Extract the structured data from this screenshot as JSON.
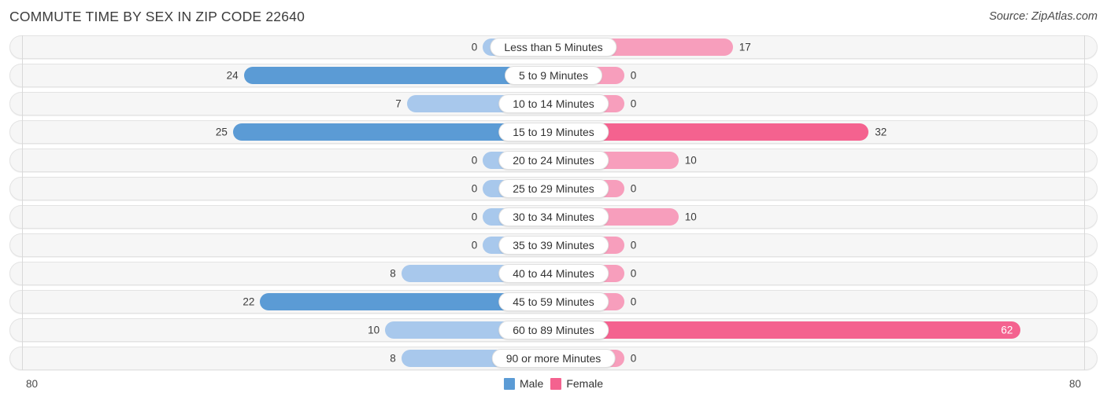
{
  "header": {
    "title": "COMMUTE TIME BY SEX IN ZIP CODE 22640",
    "source": "Source: ZipAtlas.com"
  },
  "legend": {
    "male_label": "Male",
    "female_label": "Female",
    "male_color": "#5b9bd5",
    "female_color": "#f4628f"
  },
  "axis": {
    "left_label": "80",
    "right_label": "80"
  },
  "chart_data": {
    "type": "bar",
    "title": "COMMUTE TIME BY SEX IN ZIP CODE 22640",
    "orientation": "horizontal-diverging",
    "xlabel": "",
    "ylabel": "",
    "xlim": [
      80,
      80
    ],
    "grid": false,
    "legend_position": "bottom-center",
    "categories": [
      "Less than 5 Minutes",
      "5 to 9 Minutes",
      "10 to 14 Minutes",
      "15 to 19 Minutes",
      "20 to 24 Minutes",
      "25 to 29 Minutes",
      "30 to 34 Minutes",
      "35 to 39 Minutes",
      "40 to 44 Minutes",
      "45 to 59 Minutes",
      "60 to 89 Minutes",
      "90 or more Minutes"
    ],
    "series": [
      {
        "name": "Male",
        "color": "#5b9bd5",
        "values": [
          0,
          24,
          7,
          25,
          0,
          0,
          0,
          0,
          8,
          22,
          10,
          8
        ]
      },
      {
        "name": "Female",
        "color": "#f4628f",
        "values": [
          17,
          0,
          0,
          32,
          10,
          0,
          10,
          0,
          0,
          0,
          62,
          0
        ]
      }
    ]
  },
  "rows": [
    {
      "label": "Less than 5 Minutes",
      "male": "0",
      "female": "17",
      "male_pct": 13,
      "female_pct": 33,
      "male_strong": false,
      "female_strong": false,
      "female_inside": false
    },
    {
      "label": "5 to 9 Minutes",
      "male": "24",
      "female": "0",
      "male_pct": 57,
      "female_pct": 13,
      "male_strong": true,
      "female_strong": false,
      "female_inside": false
    },
    {
      "label": "10 to 14 Minutes",
      "male": "7",
      "female": "0",
      "male_pct": 27,
      "female_pct": 13,
      "male_strong": false,
      "female_strong": false,
      "female_inside": false
    },
    {
      "label": "15 to 19 Minutes",
      "male": "25",
      "female": "32",
      "male_pct": 59,
      "female_pct": 58,
      "male_strong": true,
      "female_strong": true,
      "female_inside": false
    },
    {
      "label": "20 to 24 Minutes",
      "male": "0",
      "female": "10",
      "male_pct": 13,
      "female_pct": 23,
      "male_strong": false,
      "female_strong": false,
      "female_inside": false
    },
    {
      "label": "25 to 29 Minutes",
      "male": "0",
      "female": "0",
      "male_pct": 13,
      "female_pct": 13,
      "male_strong": false,
      "female_strong": false,
      "female_inside": false
    },
    {
      "label": "30 to 34 Minutes",
      "male": "0",
      "female": "10",
      "male_pct": 13,
      "female_pct": 23,
      "male_strong": false,
      "female_strong": false,
      "female_inside": false
    },
    {
      "label": "35 to 39 Minutes",
      "male": "0",
      "female": "0",
      "male_pct": 13,
      "female_pct": 13,
      "male_strong": false,
      "female_strong": false,
      "female_inside": false
    },
    {
      "label": "40 to 44 Minutes",
      "male": "8",
      "female": "0",
      "male_pct": 28,
      "female_pct": 13,
      "male_strong": false,
      "female_strong": false,
      "female_inside": false
    },
    {
      "label": "45 to 59 Minutes",
      "male": "22",
      "female": "0",
      "male_pct": 54,
      "female_pct": 13,
      "male_strong": true,
      "female_strong": false,
      "female_inside": false
    },
    {
      "label": "60 to 89 Minutes",
      "male": "10",
      "female": "62",
      "male_pct": 31,
      "female_pct": 86,
      "male_strong": false,
      "female_strong": true,
      "female_inside": true
    },
    {
      "label": "90 or more Minutes",
      "male": "8",
      "female": "0",
      "male_pct": 28,
      "female_pct": 13,
      "male_strong": false,
      "female_strong": false,
      "female_inside": false
    }
  ]
}
